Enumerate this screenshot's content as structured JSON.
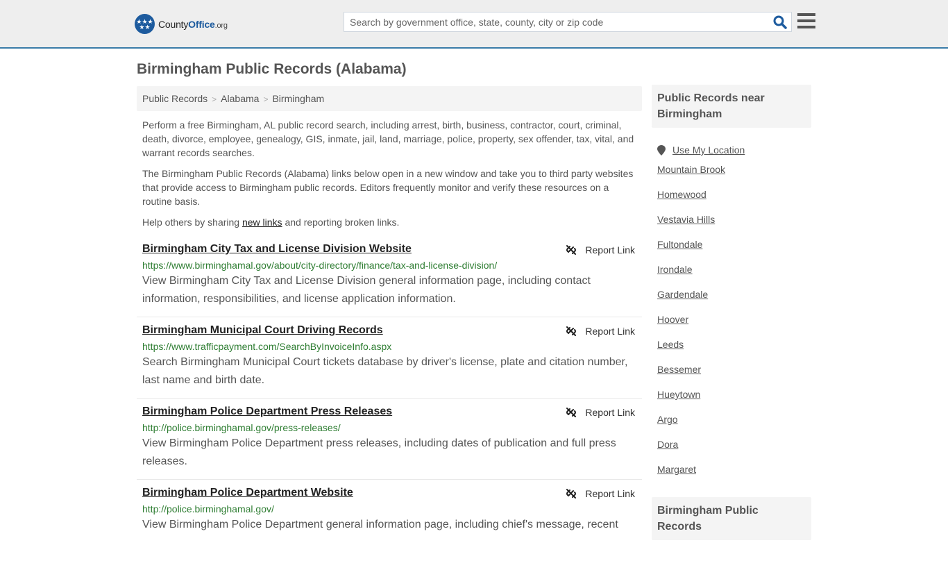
{
  "header": {
    "logo": {
      "part1": "County",
      "part2": "Office",
      "part3": ".org"
    },
    "search": {
      "placeholder": "Search by government office, state, county, city or zip code",
      "value": ""
    },
    "icons": {
      "search": "search-icon",
      "menu": "hamburger-menu-icon"
    }
  },
  "page": {
    "title": "Birmingham Public Records (Alabama)",
    "breadcrumb": [
      "Public Records",
      "Alabama",
      "Birmingham"
    ],
    "breadcrumb_separator": ">",
    "intro": {
      "p1": "Perform a free Birmingham, AL public record search, including arrest, birth, business, contractor, court, criminal, death, divorce, employee, genealogy, GIS, inmate, jail, land, marriage, police, property, sex offender, tax, vital, and warrant records searches.",
      "p2": "The Birmingham Public Records (Alabama) links below open in a new window and take you to third party websites that provide access to Birmingham public records. Editors frequently monitor and verify these resources on a routine basis.",
      "p3_before": "Help others by sharing ",
      "p3_link": "new links",
      "p3_after": " and reporting broken links."
    }
  },
  "records": [
    {
      "title": "Birmingham City Tax and License Division Website",
      "url": "https://www.birminghamal.gov/about/city-directory/finance/tax-and-license-division/",
      "description": "View Birmingham City Tax and License Division general information page, including contact information, responsibilities, and license application information.",
      "report_label": "Report Link"
    },
    {
      "title": "Birmingham Municipal Court Driving Records",
      "url": "https://www.trafficpayment.com/SearchByInvoiceInfo.aspx",
      "description": "Search Birmingham Municipal Court tickets database by driver's license, plate and citation number, last name and birth date.",
      "report_label": "Report Link"
    },
    {
      "title": "Birmingham Police Department Press Releases",
      "url": "http://police.birminghamal.gov/press-releases/",
      "description": "View Birmingham Police Department press releases, including dates of publication and full press releases.",
      "report_label": "Report Link"
    },
    {
      "title": "Birmingham Police Department Website",
      "url": "http://police.birminghamal.gov/",
      "description": "View Birmingham Police Department general information page, including chief's message, recent",
      "report_label": "Report Link"
    }
  ],
  "sidebar": {
    "nearby_heading": "Public Records near Birmingham",
    "use_location": "Use My Location",
    "places": [
      "Mountain Brook",
      "Homewood",
      "Vestavia Hills",
      "Fultondale",
      "Irondale",
      "Gardendale",
      "Hoover",
      "Leeds",
      "Bessemer",
      "Hueytown",
      "Argo",
      "Dora",
      "Margaret"
    ],
    "second_heading": "Birmingham Public Records"
  },
  "colors": {
    "brand": "#1d5b9e",
    "header_border": "#3a7ca8",
    "url_green": "#2e7d32"
  }
}
